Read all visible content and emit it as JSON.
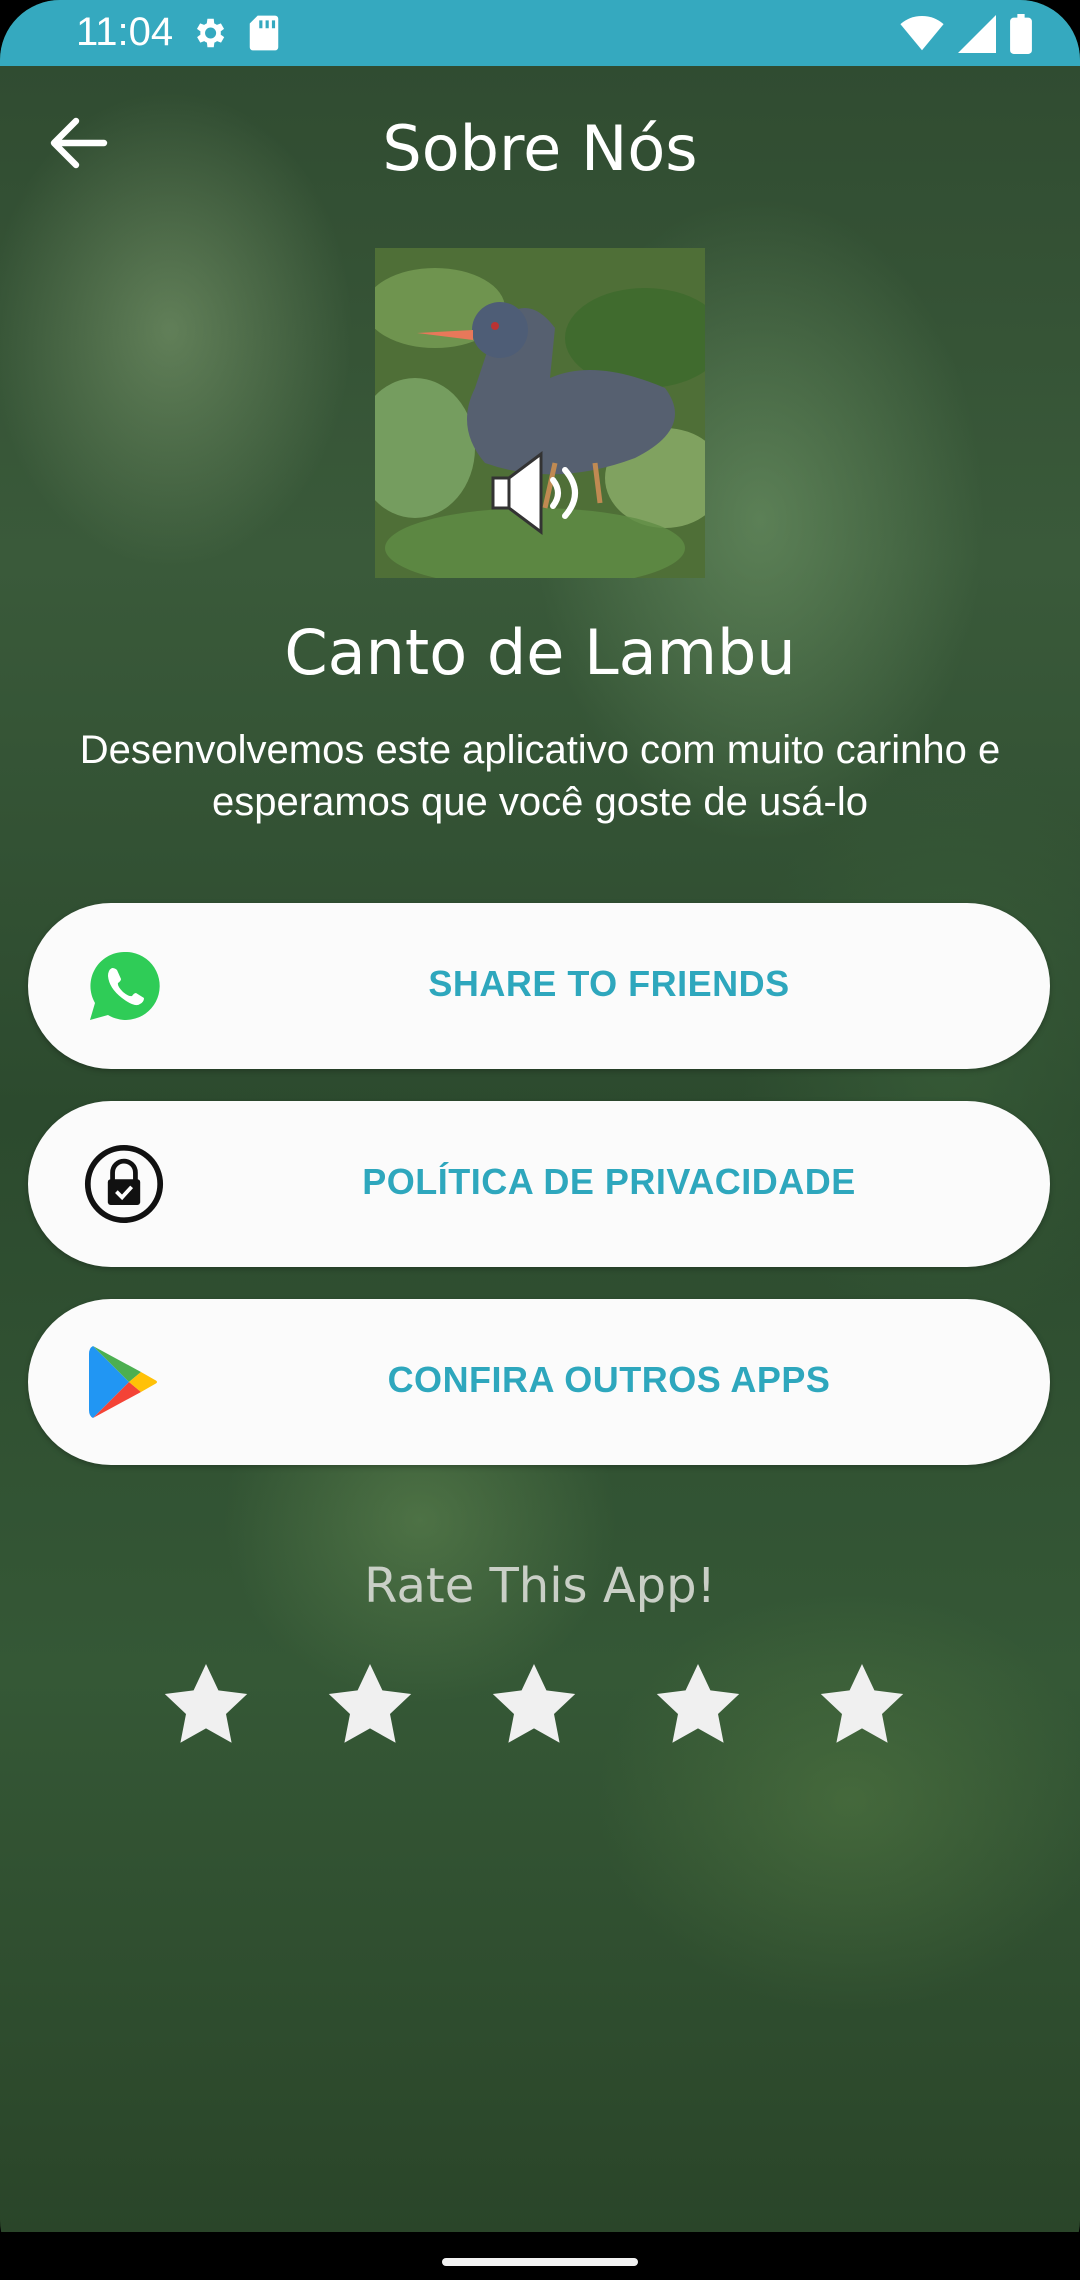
{
  "status_bar": {
    "time": "11:04",
    "left_icons": [
      "settings-icon",
      "sd-card-icon"
    ],
    "right_icons": [
      "wifi-icon",
      "signal-icon",
      "battery-icon"
    ],
    "color": "#35a9bf"
  },
  "header": {
    "title": "Sobre Nós",
    "back_icon": "arrow-left-icon"
  },
  "app": {
    "image": "bird-photo",
    "sound_icon": "speaker-icon",
    "name": "Canto de Lambu",
    "description": "Desenvolvemos este aplicativo com muito carinho e esperamos que você goste de usá-lo"
  },
  "actions": [
    {
      "label": "SHARE TO FRIENDS",
      "icon": "whatsapp-icon"
    },
    {
      "label": "POLÍTICA DE PRIVACIDADE",
      "icon": "lock-icon"
    },
    {
      "label": "CONFIRA OUTROS APPS",
      "icon": "google-play-icon"
    }
  ],
  "rating": {
    "title": "Rate This App!",
    "max_stars": 5,
    "selected": 0
  },
  "colors": {
    "accent": "#2ea7bd",
    "button_bg": "#fbfbfb",
    "star": "#f0f0f0"
  }
}
